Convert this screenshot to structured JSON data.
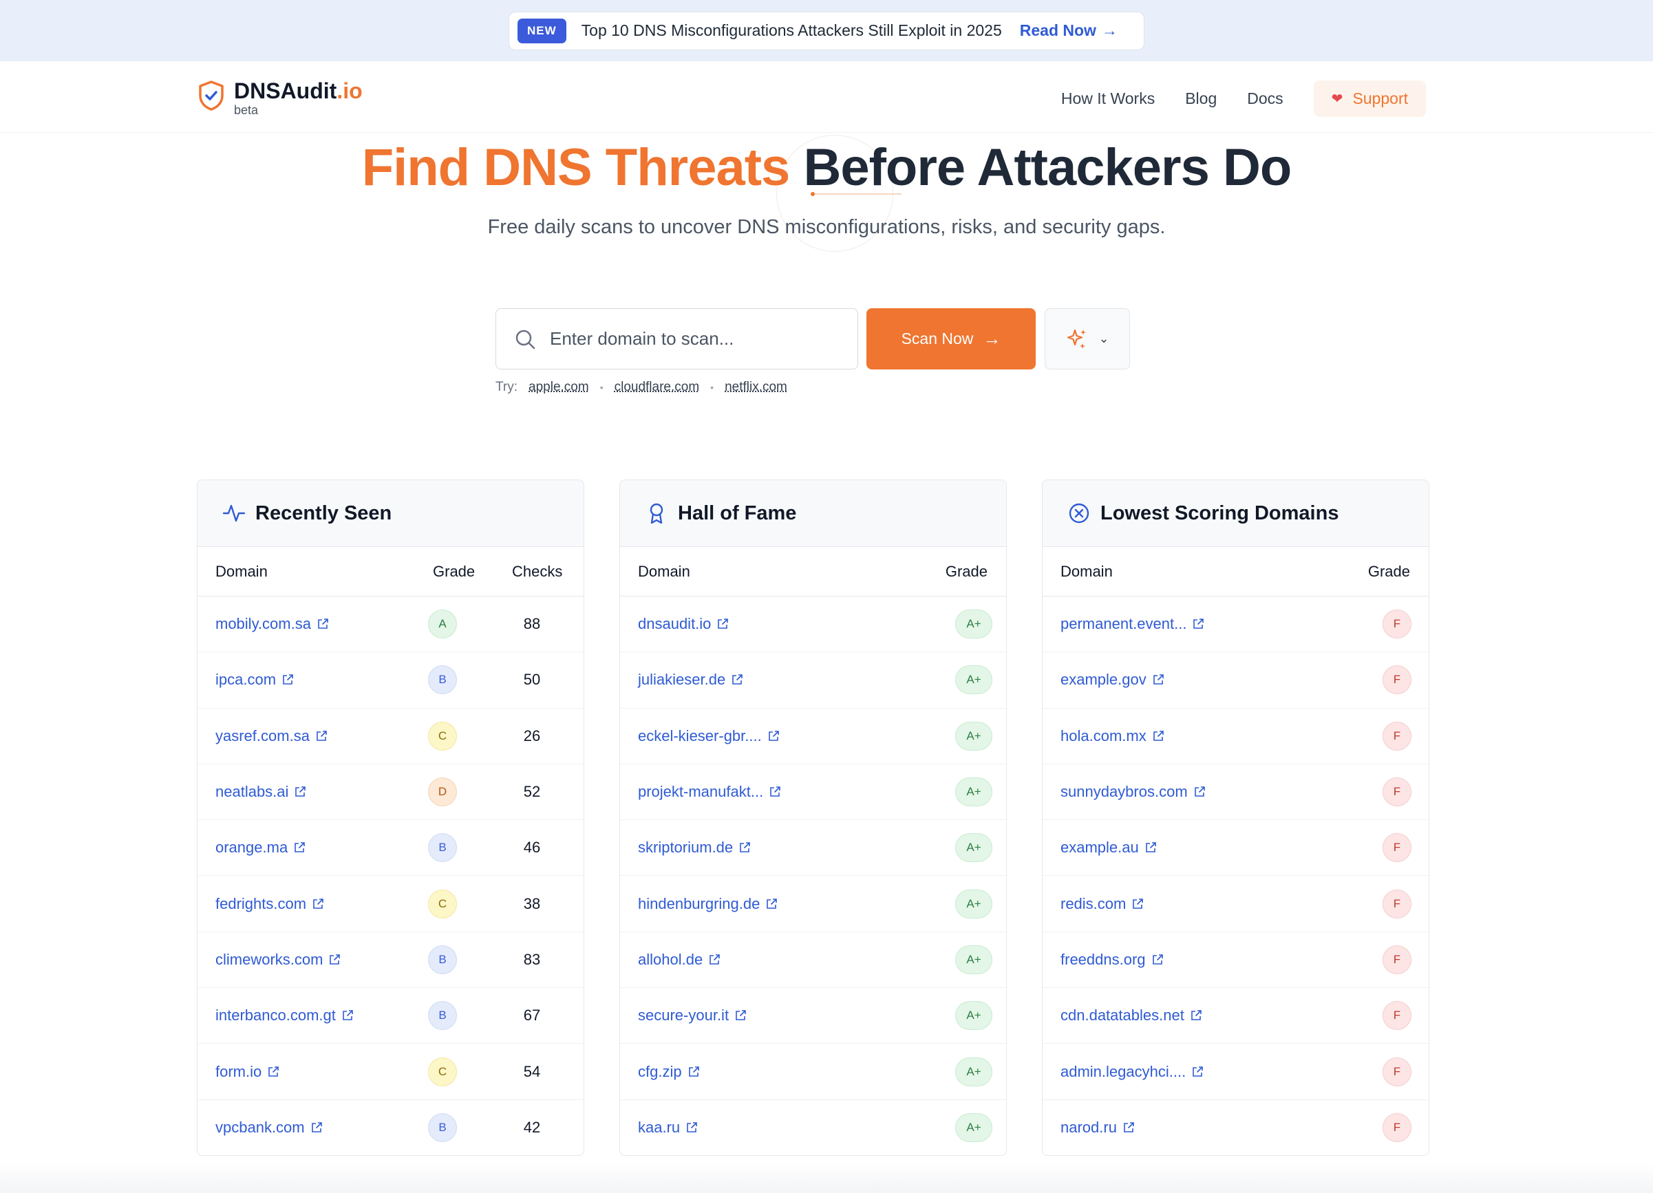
{
  "announcement": {
    "badge": "NEW",
    "text": "Top 10 DNS Misconfigurations Attackers Still Exploit in 2025",
    "link": "Read Now"
  },
  "header": {
    "logo_name": "DNSAudit",
    "logo_tld": ".io",
    "logo_sub": "beta",
    "nav": [
      "How It Works",
      "Blog",
      "Docs"
    ],
    "support": "Support"
  },
  "hero": {
    "title_accent": "Find DNS Threats",
    "title_rest": "Before Attackers Do",
    "subtitle": "Free daily scans to uncover DNS misconfigurations, risks, and security gaps."
  },
  "search": {
    "placeholder": "Enter domain to scan...",
    "button": "Scan Now",
    "try_label": "Try:",
    "suggestions": [
      "apple.com",
      "cloudflare.com",
      "netflix.com"
    ]
  },
  "recently_seen": {
    "title": "Recently Seen",
    "columns": [
      "Domain",
      "Grade",
      "Checks"
    ],
    "rows": [
      {
        "domain": "mobily.com.sa",
        "grade": "A",
        "checks": "88"
      },
      {
        "domain": "ipca.com",
        "grade": "B",
        "checks": "50"
      },
      {
        "domain": "yasref.com.sa",
        "grade": "C",
        "checks": "26"
      },
      {
        "domain": "neatlabs.ai",
        "grade": "D",
        "checks": "52"
      },
      {
        "domain": "orange.ma",
        "grade": "B",
        "checks": "46"
      },
      {
        "domain": "fedrights.com",
        "grade": "C",
        "checks": "38"
      },
      {
        "domain": "climeworks.com",
        "grade": "B",
        "checks": "83"
      },
      {
        "domain": "interbanco.com.gt",
        "grade": "B",
        "checks": "67"
      },
      {
        "domain": "form.io",
        "grade": "C",
        "checks": "54"
      },
      {
        "domain": "vpcbank.com",
        "grade": "B",
        "checks": "42"
      }
    ]
  },
  "hall_of_fame": {
    "title": "Hall of Fame",
    "columns": [
      "Domain",
      "Grade"
    ],
    "rows": [
      {
        "domain": "dnsaudit.io",
        "grade": "A+"
      },
      {
        "domain": "juliakieser.de",
        "grade": "A+"
      },
      {
        "domain": "eckel-kieser-gbr....",
        "grade": "A+"
      },
      {
        "domain": "projekt-manufakt...",
        "grade": "A+"
      },
      {
        "domain": "skriptorium.de",
        "grade": "A+"
      },
      {
        "domain": "hindenburgring.de",
        "grade": "A+"
      },
      {
        "domain": "allohol.de",
        "grade": "A+"
      },
      {
        "domain": "secure-your.it",
        "grade": "A+"
      },
      {
        "domain": "cfg.zip",
        "grade": "A+"
      },
      {
        "domain": "kaa.ru",
        "grade": "A+"
      }
    ]
  },
  "lowest_scoring": {
    "title": "Lowest Scoring Domains",
    "columns": [
      "Domain",
      "Grade"
    ],
    "rows": [
      {
        "domain": "permanent.event...",
        "grade": "F"
      },
      {
        "domain": "example.gov",
        "grade": "F"
      },
      {
        "domain": "hola.com.mx",
        "grade": "F"
      },
      {
        "domain": "sunnydaybros.com",
        "grade": "F"
      },
      {
        "domain": "example.au",
        "grade": "F"
      },
      {
        "domain": "redis.com",
        "grade": "F"
      },
      {
        "domain": "freeddns.org",
        "grade": "F"
      },
      {
        "domain": "cdn.datatables.net",
        "grade": "F"
      },
      {
        "domain": "admin.legacyhci....",
        "grade": "F"
      },
      {
        "domain": "narod.ru",
        "grade": "F"
      }
    ]
  },
  "colors": {
    "accent": "#ef7530",
    "link": "#2f5bd3",
    "announce_bg": "#e8effa"
  }
}
